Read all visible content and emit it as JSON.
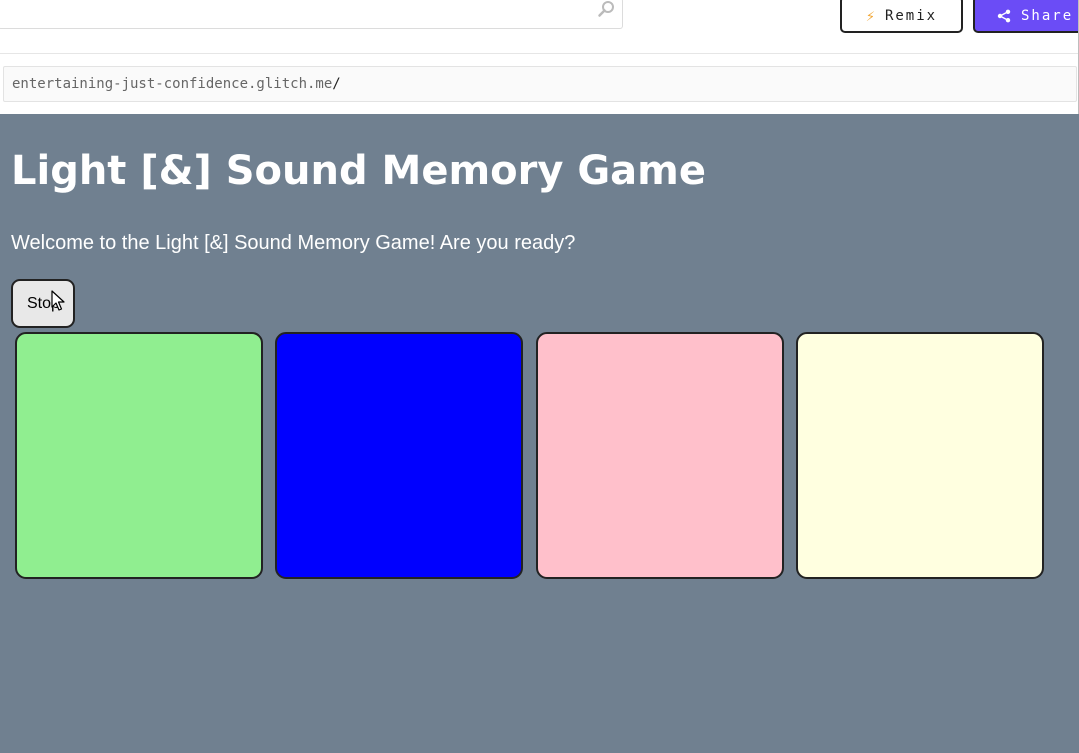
{
  "header": {
    "remix_label": "Remix",
    "remix_icon": "lightning-bolt-icon",
    "share_label": "Share",
    "share_icon": "share-icon",
    "search_icon": "search-icon"
  },
  "urlbar": {
    "host": "entertaining-just-confidence.glitch.me",
    "path": "/"
  },
  "game": {
    "title": "Light [&] Sound Memory Game",
    "welcome": "Welcome to the Light [&] Sound Memory Game! Are you ready?",
    "stop_label": "Stop",
    "buttons": [
      {
        "color": "#90ee90"
      },
      {
        "color": "#0000ff"
      },
      {
        "color": "#ffc0cb"
      },
      {
        "color": "#ffffe0"
      }
    ]
  },
  "colors": {
    "background": "#708090",
    "share_accent": "#6b4cf6",
    "bolt": "#f2a93b"
  }
}
